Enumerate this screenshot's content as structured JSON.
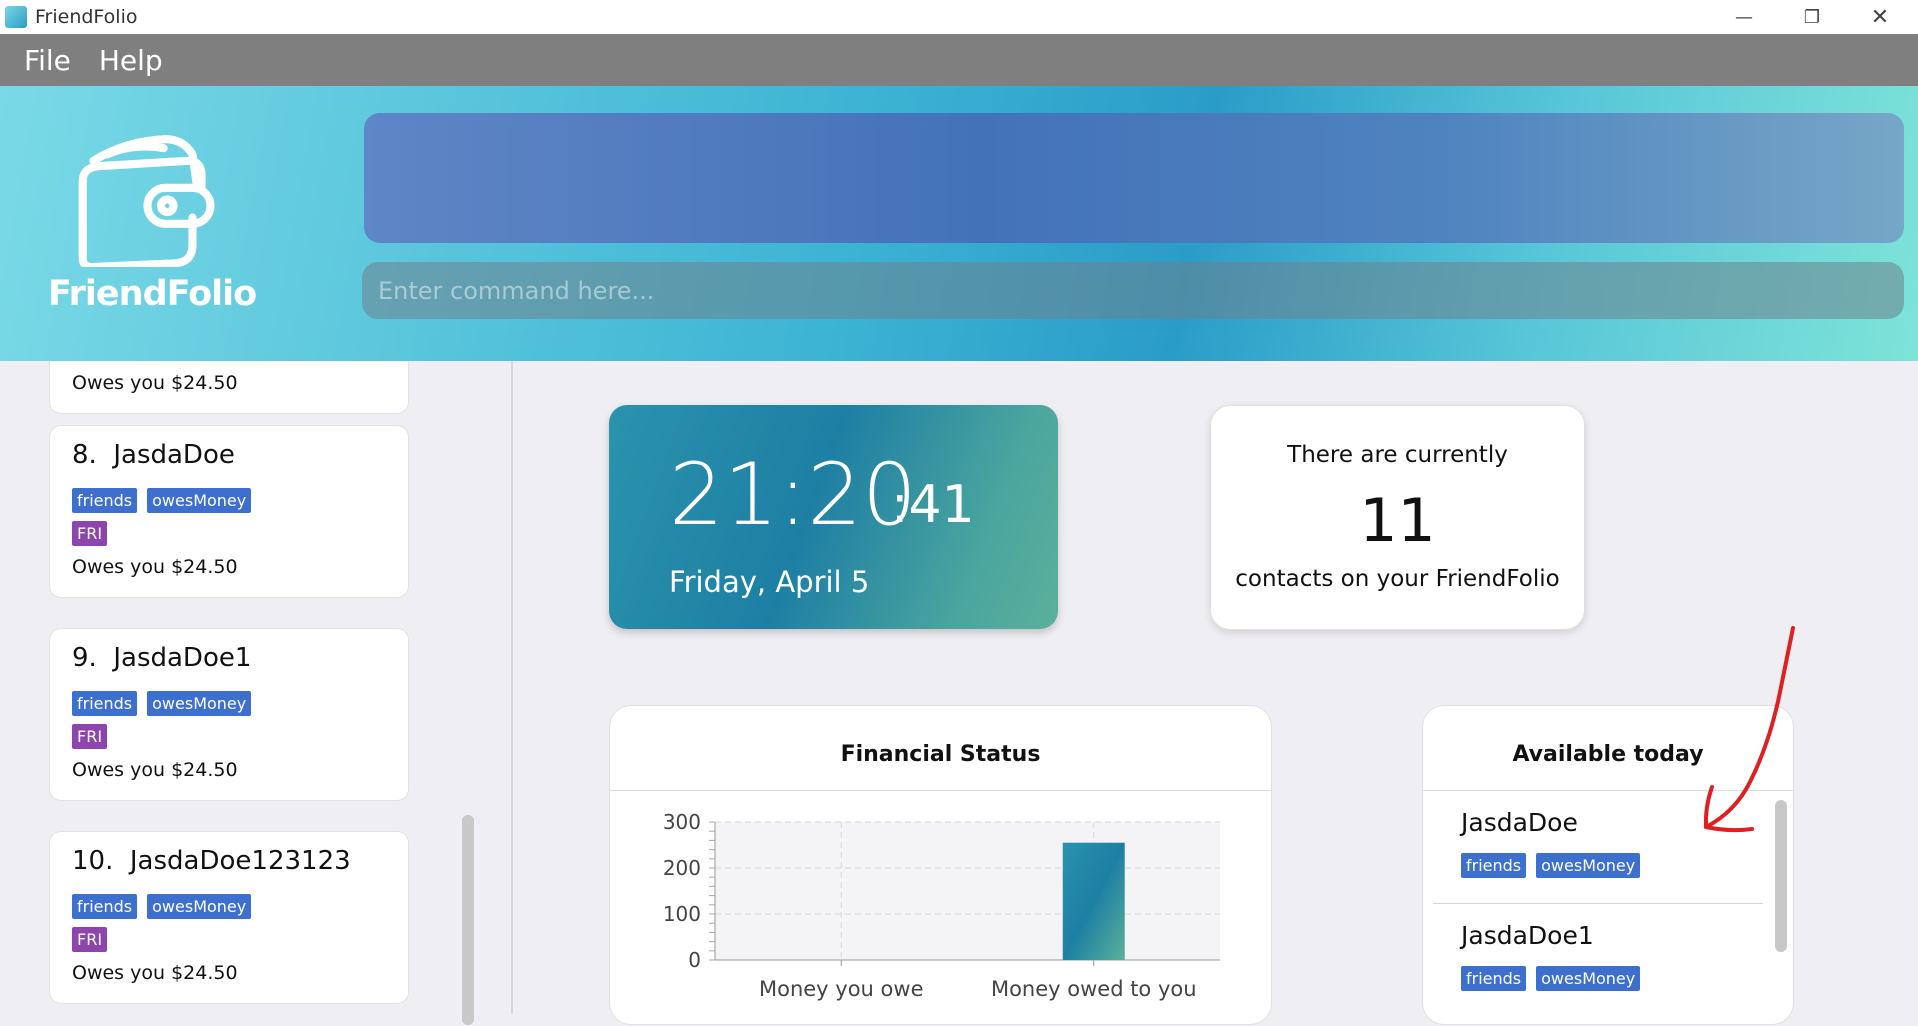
{
  "window": {
    "title": "FriendFolio",
    "minimize": "—",
    "maximize": "❐",
    "close": "✕"
  },
  "menu": {
    "items": [
      "File",
      "Help"
    ]
  },
  "header": {
    "logo_text": "FriendFolio",
    "command_placeholder": "Enter command here..."
  },
  "sidebar": {
    "partial_owe": "Owes you $24.50",
    "contacts": [
      {
        "index": "8.",
        "name": "JasdaDoe",
        "tags": [
          "friends",
          "owesMoney"
        ],
        "day": "FRI",
        "owe": "Owes you $24.50"
      },
      {
        "index": "9.",
        "name": "JasdaDoe1",
        "tags": [
          "friends",
          "owesMoney"
        ],
        "day": "FRI",
        "owe": "Owes you $24.50"
      },
      {
        "index": "10.",
        "name": "JasdaDoe123123",
        "tags": [
          "friends",
          "owesMoney"
        ],
        "day": "FRI",
        "owe": "Owes you $24.50"
      }
    ]
  },
  "clock": {
    "hours_minutes": "21:20",
    "seconds": ":41",
    "date": "Friday, April 5"
  },
  "contacts_summary": {
    "line1": "There are currently",
    "count": "11",
    "line2": "contacts on your FriendFolio"
  },
  "financial": {
    "title": "Financial Status"
  },
  "chart_data": {
    "type": "bar",
    "title": "Financial Status",
    "categories": [
      "Money you owe",
      "Money owed to you"
    ],
    "values": [
      0,
      255
    ],
    "ylim": [
      0,
      300
    ],
    "yticks": [
      0,
      100,
      200,
      300
    ],
    "grid": true,
    "bar_color": "#2a93ad"
  },
  "available": {
    "title": "Available today",
    "items": [
      {
        "name": "JasdaDoe",
        "tags": [
          "friends",
          "owesMoney"
        ]
      },
      {
        "name": "JasdaDoe1",
        "tags": [
          "friends",
          "owesMoney"
        ]
      }
    ]
  },
  "colors": {
    "tag": "#3d6fcf",
    "day_tag": "#8e44ad",
    "annotation": "#e02020"
  }
}
